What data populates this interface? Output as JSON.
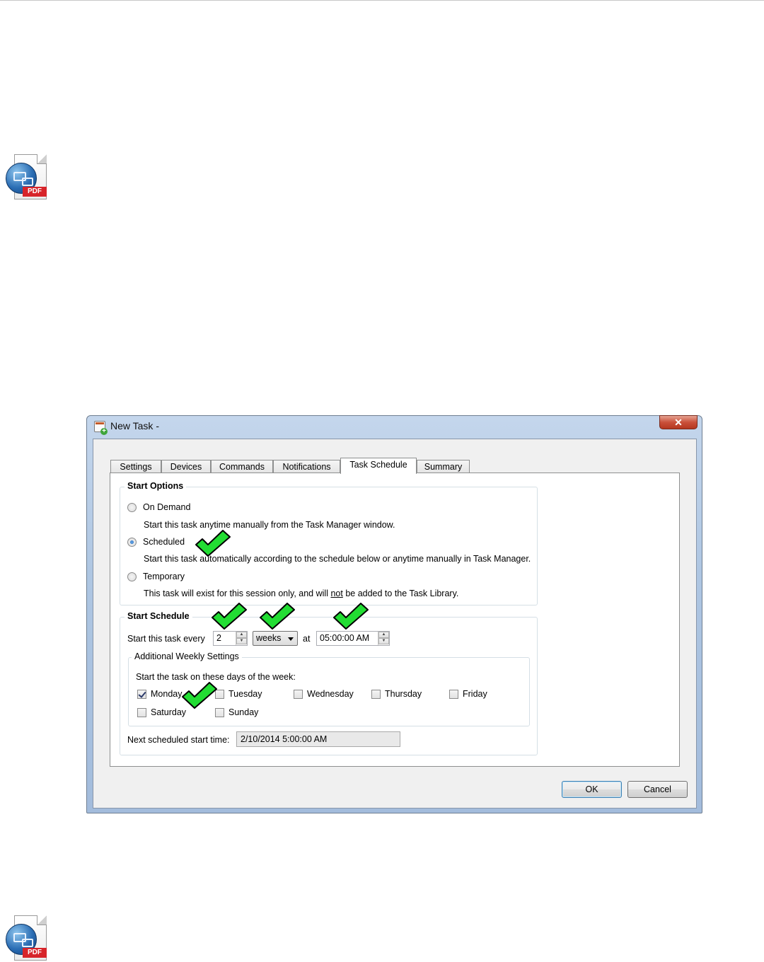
{
  "doc_icon": {
    "label": "PDF"
  },
  "window": {
    "title": "New Task -",
    "close_label": "✕"
  },
  "tabs": [
    {
      "label": "Settings",
      "active": false
    },
    {
      "label": "Devices",
      "active": false
    },
    {
      "label": "Commands",
      "active": false
    },
    {
      "label": "Notifications",
      "active": false
    },
    {
      "label": "Task Schedule",
      "active": true
    },
    {
      "label": "Summary",
      "active": false
    }
  ],
  "start_options": {
    "title": "Start Options",
    "on_demand": {
      "label": "On Demand",
      "description": "Start this task anytime manually from the Task Manager window.",
      "selected": false
    },
    "scheduled": {
      "label": "Scheduled",
      "description": "Start this task automatically according to the schedule below or anytime manually in Task Manager.",
      "selected": true
    },
    "temporary": {
      "label": "Temporary",
      "description_before": "This task will exist for this session only, and will ",
      "description_underlined": "not",
      "description_after": " be added to the Task Library.",
      "selected": false
    }
  },
  "start_schedule": {
    "title": "Start Schedule",
    "every_label": "Start this task every",
    "every_value": "2",
    "unit_value": "weeks",
    "at_label": "at",
    "time_value": "05:00:00 AM",
    "weekly": {
      "title": "Additional Weekly Settings",
      "instruction": "Start the task on these days of the week:",
      "days": [
        {
          "label": "Monday",
          "checked": true
        },
        {
          "label": "Tuesday",
          "checked": false
        },
        {
          "label": "Wednesday",
          "checked": false
        },
        {
          "label": "Thursday",
          "checked": false
        },
        {
          "label": "Friday",
          "checked": false
        },
        {
          "label": "Saturday",
          "checked": false
        },
        {
          "label": "Sunday",
          "checked": false
        }
      ]
    },
    "next_label": "Next scheduled start time:",
    "next_value": "2/10/2014 5:00:00 AM"
  },
  "buttons": {
    "ok": "OK",
    "cancel": "Cancel"
  },
  "colors": {
    "checkmark_fill": "#22dd33",
    "checkmark_outline": "#000000",
    "window_frame": "#aec6e2"
  }
}
